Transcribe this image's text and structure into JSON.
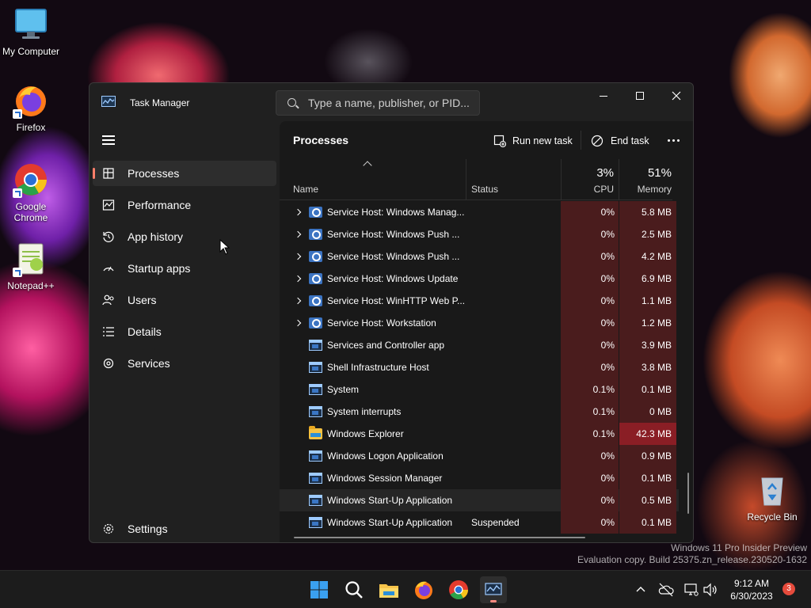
{
  "desktop": {
    "icons": [
      {
        "label": "My Computer",
        "icon": "monitor-icon"
      },
      {
        "label": "Firefox",
        "icon": "firefox-icon"
      },
      {
        "label_line1": "Google",
        "label_line2": "Chrome",
        "icon": "chrome-icon"
      },
      {
        "label": "Notepad++",
        "icon": "notepadpp-icon"
      },
      {
        "label": "Recycle Bin",
        "icon": "recycle-bin-icon"
      }
    ],
    "watermark_line1": "Windows 11 Pro Insider Preview",
    "watermark_line2": "Evaluation copy. Build 25375.zn_release.230520-1632"
  },
  "window": {
    "title": "Task Manager",
    "search_placeholder": "Type a name, publisher, or PID..."
  },
  "sidebar": {
    "items": [
      {
        "label": "Processes",
        "icon": "processes-icon",
        "active": true
      },
      {
        "label": "Performance",
        "icon": "performance-icon"
      },
      {
        "label": "App history",
        "icon": "app-history-icon"
      },
      {
        "label": "Startup apps",
        "icon": "startup-apps-icon"
      },
      {
        "label": "Users",
        "icon": "users-icon"
      },
      {
        "label": "Details",
        "icon": "details-icon"
      },
      {
        "label": "Services",
        "icon": "services-icon"
      }
    ],
    "settings_label": "Settings"
  },
  "toolbar": {
    "page_title": "Processes",
    "run_new_task": "Run new task",
    "end_task": "End task"
  },
  "columns": {
    "name": "Name",
    "status": "Status",
    "cpu_pct": "3%",
    "cpu": "CPU",
    "memory_pct": "51%",
    "memory": "Memory"
  },
  "processes": [
    {
      "name": "Service Host: Windows Manag...",
      "status": "",
      "cpu": "0%",
      "memory": "5.8 MB",
      "icon": "gear",
      "expandable": true
    },
    {
      "name": "Service Host: Windows Push ...",
      "status": "",
      "cpu": "0%",
      "memory": "2.5 MB",
      "icon": "gear",
      "expandable": true
    },
    {
      "name": "Service Host: Windows Push ...",
      "status": "",
      "cpu": "0%",
      "memory": "4.2 MB",
      "icon": "gear",
      "expandable": true
    },
    {
      "name": "Service Host: Windows Update",
      "status": "",
      "cpu": "0%",
      "memory": "6.9 MB",
      "icon": "gear",
      "expandable": true
    },
    {
      "name": "Service Host: WinHTTP Web P...",
      "status": "",
      "cpu": "0%",
      "memory": "1.1 MB",
      "icon": "gear",
      "expandable": true
    },
    {
      "name": "Service Host: Workstation",
      "status": "",
      "cpu": "0%",
      "memory": "1.2 MB",
      "icon": "gear",
      "expandable": true
    },
    {
      "name": "Services and Controller app",
      "status": "",
      "cpu": "0%",
      "memory": "3.9 MB",
      "icon": "app",
      "expandable": false
    },
    {
      "name": "Shell Infrastructure Host",
      "status": "",
      "cpu": "0%",
      "memory": "3.8 MB",
      "icon": "app",
      "expandable": false
    },
    {
      "name": "System",
      "status": "",
      "cpu": "0.1%",
      "memory": "0.1 MB",
      "icon": "app",
      "expandable": false
    },
    {
      "name": "System interrupts",
      "status": "",
      "cpu": "0.1%",
      "memory": "0 MB",
      "icon": "app",
      "expandable": false
    },
    {
      "name": "Windows Explorer",
      "status": "",
      "cpu": "0.1%",
      "memory": "42.3 MB",
      "icon": "folder",
      "expandable": false,
      "hot": true
    },
    {
      "name": "Windows Logon Application",
      "status": "",
      "cpu": "0%",
      "memory": "0.9 MB",
      "icon": "app",
      "expandable": false
    },
    {
      "name": "Windows Session Manager",
      "status": "",
      "cpu": "0%",
      "memory": "0.1 MB",
      "icon": "app",
      "expandable": false
    },
    {
      "name": "Windows Start-Up Application",
      "status": "",
      "cpu": "0%",
      "memory": "0.5 MB",
      "icon": "app",
      "expandable": false,
      "hover": true
    },
    {
      "name": "Windows Start-Up Application",
      "status": "Suspended",
      "cpu": "0%",
      "memory": "0.1 MB",
      "icon": "app",
      "expandable": false
    }
  ],
  "taskbar": {
    "apps": [
      "start-icon",
      "search-icon",
      "file-explorer-icon",
      "firefox-icon",
      "chrome-icon",
      "task-manager-icon"
    ],
    "time": "9:12 AM",
    "date": "6/30/2023",
    "notification_count": "3"
  },
  "colors": {
    "accent": "#ff7f6a",
    "heat_low": "#4a1c1d",
    "heat_high": "#8a1e25"
  }
}
